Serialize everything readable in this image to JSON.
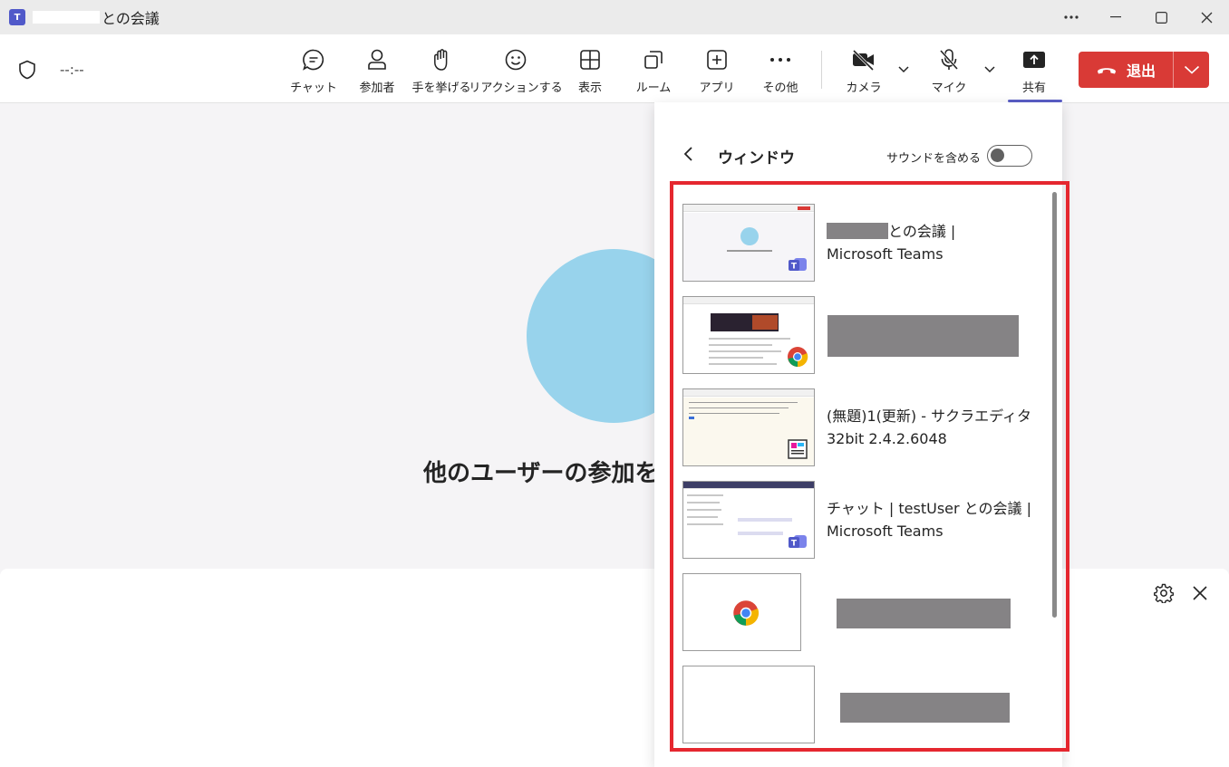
{
  "titlebar": {
    "title": "との会議",
    "app_icon": "teams-icon",
    "controls": [
      "more-icon",
      "minimize-icon",
      "maximize-icon",
      "close-icon"
    ]
  },
  "toolbar": {
    "timer": "--:--",
    "buttons": [
      {
        "label": "チャット",
        "icon": "chat-icon"
      },
      {
        "label": "参加者",
        "icon": "people-icon"
      },
      {
        "label": "手を挙げる",
        "icon": "raise-hand-icon"
      },
      {
        "label": "リアクションする",
        "icon": "smiley-icon"
      },
      {
        "label": "表示",
        "icon": "grid-icon"
      },
      {
        "label": "ルーム",
        "icon": "rooms-icon"
      },
      {
        "label": "アプリ",
        "icon": "add-app-icon"
      },
      {
        "label": "その他",
        "icon": "more-icon"
      },
      {
        "label": "カメラ",
        "icon": "camera-off-icon"
      },
      {
        "label": "マイク",
        "icon": "mic-off-icon"
      },
      {
        "label": "共有",
        "icon": "share-icon"
      }
    ],
    "leave_label": "退出"
  },
  "stage": {
    "waiting_text": "他のユーザーの参加を"
  },
  "share_panel": {
    "title": "ウィンドウ",
    "sound_label": "サウンドを含める",
    "sound_on": false,
    "windows": [
      {
        "line1": "との会議 |",
        "line2": "Microsoft Teams",
        "app": "teams-icon"
      },
      {
        "line1": "",
        "line2": "",
        "app": "chrome-icon"
      },
      {
        "line1": "(無題)1(更新) - サクラエディタ",
        "line2": "32bit 2.4.2.6048",
        "app": "sakura-editor-icon"
      },
      {
        "line1": "チャット | testUser との会議 |",
        "line2": "Microsoft Teams",
        "app": "teams-icon"
      },
      {
        "line1": "",
        "line2": "",
        "app": "chrome-icon"
      },
      {
        "line1": "",
        "line2": "",
        "app": ""
      }
    ]
  },
  "colors": {
    "accent": "#5b5fc7",
    "leave": "#d93a36",
    "highlight_border": "#e5272f",
    "avatar": "#98d3ec",
    "redaction": "#858385"
  }
}
